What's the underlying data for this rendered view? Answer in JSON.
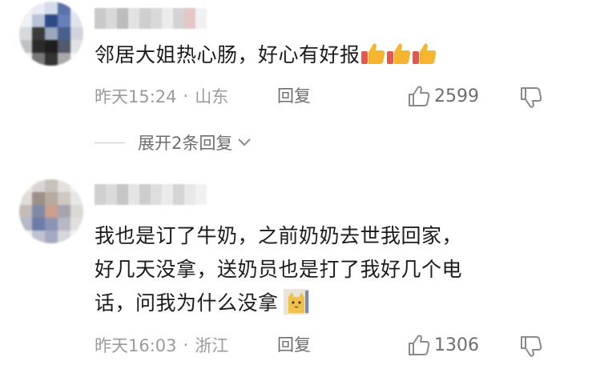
{
  "comments": [
    {
      "text": "邻居大姐热心肠，好心有好报",
      "emoji": "thumbs-up",
      "time": "昨天15:24",
      "location": "山东",
      "reply_label": "回复",
      "likes": "2599",
      "expand_label": "展开2条回复"
    },
    {
      "text": "我也是订了牛奶，之前奶奶去世我回家，\n好几天没拿，送奶员也是打了我好几个电\n话，问我为什么没拿",
      "emoji": "cat",
      "time": "昨天16:03",
      "location": "浙江",
      "reply_label": "回复",
      "likes": "1306"
    }
  ],
  "separator": "·",
  "colors": {
    "meta_gray": "#9b9b9b",
    "text_dark": "#1c1c1c",
    "thumb_orange": "#f5b52e",
    "thumb_red": "#e2584f"
  }
}
